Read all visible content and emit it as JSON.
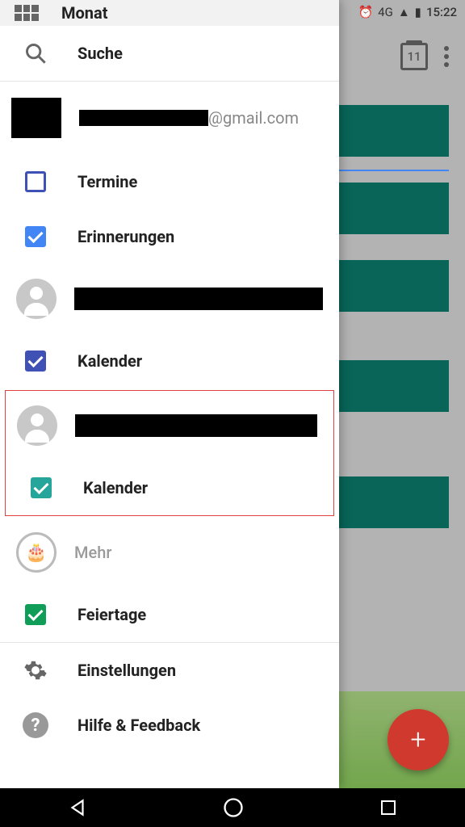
{
  "status_bar": {
    "time": "15:22",
    "network": "4G"
  },
  "bg_toolbar": {
    "today_date": "11"
  },
  "drawer": {
    "top_item": "Monat",
    "search": "Suche",
    "account1": {
      "email_suffix": "@gmail.com"
    },
    "items": {
      "termine": "Termine",
      "erinnerungen": "Erinnerungen",
      "kalender1": "Kalender",
      "kalender2": "Kalender",
      "mehr": "Mehr",
      "feiertage": "Feiertage"
    },
    "settings": "Einstellungen",
    "help": "Hilfe & Feedback"
  }
}
